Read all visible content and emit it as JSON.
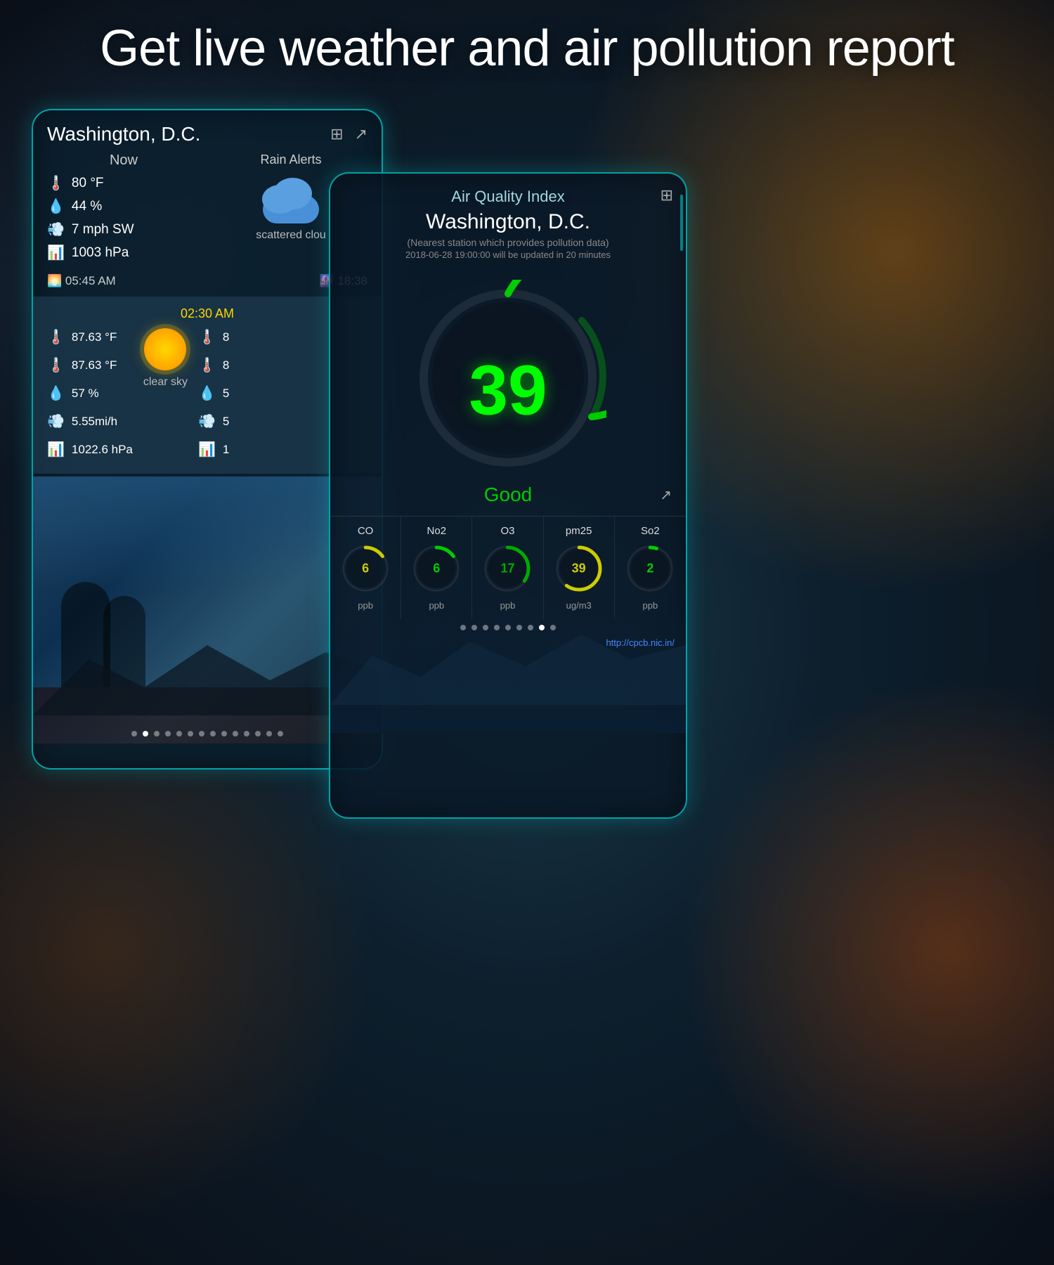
{
  "page": {
    "headline": "Get live weather and air pollution report",
    "bg_color": "#0a1520"
  },
  "weather_card": {
    "city": "Washington, D.C.",
    "now_label": "Now",
    "rain_alerts_label": "Rain Alerts",
    "temperature": "80 °F",
    "humidity": "44 %",
    "wind": "7 mph SW",
    "pressure": "1003 hPa",
    "sunrise": "05:45 AM",
    "sunset": "18:38",
    "weather_condition": "scattered clou",
    "forecast": {
      "time": "02:30 AM",
      "temp_max": "87.63 °F",
      "temp_min": "87.63 °F",
      "humidity": "57 %",
      "wind": "5.55mi/h",
      "pressure": "1022.6 hPa",
      "condition": "clear sky",
      "right_col": {
        "v1": "8",
        "v2": "8",
        "v3": "5",
        "v4": "5",
        "v5": "1"
      }
    },
    "dots": [
      false,
      true,
      false,
      false,
      false,
      false,
      false,
      false,
      false,
      false,
      false,
      false,
      false,
      false
    ]
  },
  "aqi_card": {
    "title": "Air Quality Index",
    "city": "Washington, D.C.",
    "subtitle": "(Nearest station which provides pollution data)",
    "datetime": "2018-06-28 19:00:00 will be updated in 20 minutes",
    "aqi_value": "39",
    "aqi_status": "Good",
    "pollutants": [
      {
        "name": "CO",
        "value": "6",
        "unit": "ppb",
        "arc_color": "#cccc00",
        "arc_pct": 15
      },
      {
        "name": "No2",
        "value": "6",
        "unit": "ppb",
        "arc_color": "#00cc00",
        "arc_pct": 15
      },
      {
        "name": "O3",
        "value": "17",
        "unit": "ppb",
        "arc_color": "#00aa00",
        "arc_pct": 35
      },
      {
        "name": "pm25",
        "value": "39",
        "unit": "ug/m3",
        "arc_color": "#cccc00",
        "arc_pct": 60
      },
      {
        "name": "So2",
        "value": "2",
        "unit": "ppb",
        "arc_color": "#00cc00",
        "arc_pct": 5
      }
    ],
    "source_url": "http://cpcb.nic.in/",
    "aqi_dots": [
      false,
      false,
      false,
      false,
      false,
      false,
      false,
      true,
      false
    ]
  }
}
